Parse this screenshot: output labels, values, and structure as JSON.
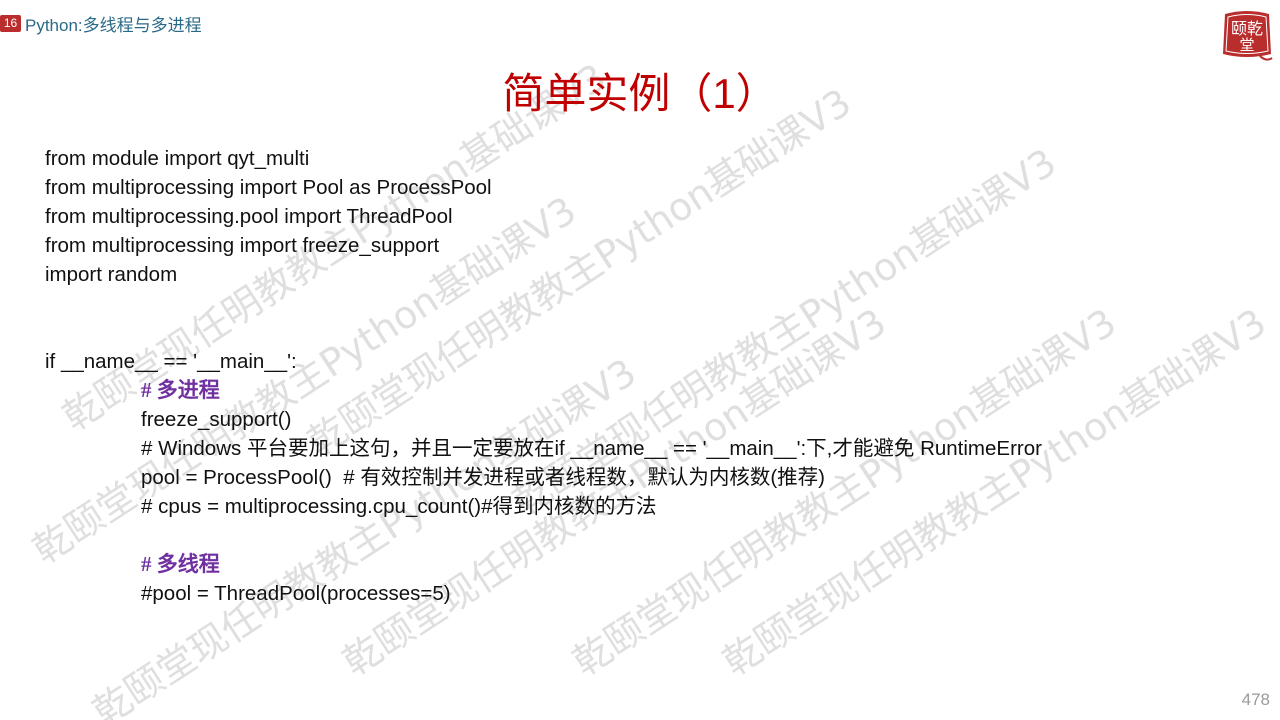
{
  "header": {
    "section_number": "16",
    "section_title": "Python:多线程与多进程"
  },
  "logo": {
    "text_top": "颐乾",
    "text_bottom": "堂",
    "color": "#b92d2d"
  },
  "title": "简单实例（1）",
  "code_lines": [
    "from module import qyt_multi",
    "from multiprocessing import Pool as ProcessPool",
    "from multiprocessing.pool import ThreadPool",
    "from multiprocessing import freeze_support",
    "import random",
    "",
    "",
    "if __name__ == '__main__':",
    "# 多进程",
    "freeze_support()",
    "# Windows 平台要加上这句，并且一定要放在if __name__ == '__main__':下,才能避免 RuntimeError",
    "pool = ProcessPool()  # 有效控制并发进程或者线程数，默认为内核数(推荐)",
    "# cpus = multiprocessing.cpu_count()#得到内核数的方法",
    "",
    "# 多线程",
    "#pool = ThreadPool(processes=5)"
  ],
  "watermark_text": "乾颐堂现任明教教主Python基础课V3",
  "page_number": "478"
}
